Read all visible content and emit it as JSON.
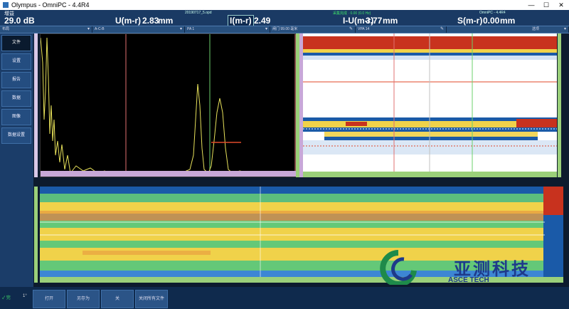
{
  "window": {
    "title": "Olympus - OmniPC - 4.4R4",
    "minimize": "—",
    "maximize": "☐",
    "close": "✕"
  },
  "readouts": {
    "gain_label": "增益",
    "gain_value": "29.0 dB",
    "file_name": "20190717_5.opd",
    "u_label": "U(m-r)",
    "u_value": "2.83",
    "u_unit": "mm",
    "i_label": "I(m-r)",
    "i_value": "2.49",
    "iu_label": "I-U(m-r)",
    "iu_value": "3.77",
    "iu_unit": "mm",
    "s_label": "S(m-r)",
    "s_value": "0.00",
    "s_unit": "mm",
    "status_text": "采集完成 · 0.00 (0.0 Hz)",
    "app_version": "OmniPC - 4.4R4"
  },
  "selector_bar": {
    "cells": [
      {
        "label": "布局",
        "icon": "dropdown-icon"
      },
      {
        "label": "A-C-B",
        "icon": "dropdown-icon"
      },
      {
        "label": "PA 1",
        "icon": "dropdown-icon"
      },
      {
        "label": "闸门  99.00 毫米",
        "icon": "edit-icon"
      },
      {
        "label": "VPA  14",
        "icon": "edit-icon"
      },
      {
        "label": "选项",
        "icon": "dropdown-icon"
      }
    ]
  },
  "sidebar": {
    "items": [
      {
        "label": "文件"
      },
      {
        "label": "设置"
      },
      {
        "label": "报告"
      },
      {
        "label": "数据"
      },
      {
        "label": "图像"
      },
      {
        "label": "数据设置"
      }
    ]
  },
  "bottombar": {
    "buttons": [
      {
        "label": "打开"
      },
      {
        "label": "另存为"
      },
      {
        "label": "关"
      },
      {
        "label": "关闭所有文件"
      }
    ],
    "left_indicator": "1°",
    "left_status": "✓ 完"
  },
  "watermark": {
    "text": "亚测科技",
    "sub": "ASCE TECH"
  },
  "colors": {
    "accent": "#1a3a64",
    "scan_red": "#c8321e",
    "scan_yellow": "#f0d24a",
    "scan_green": "#64c878",
    "scan_blue": "#1a5aa8"
  },
  "ascan": {
    "trace_color": "#e7e15a",
    "gate_color": "#e04a2a"
  }
}
